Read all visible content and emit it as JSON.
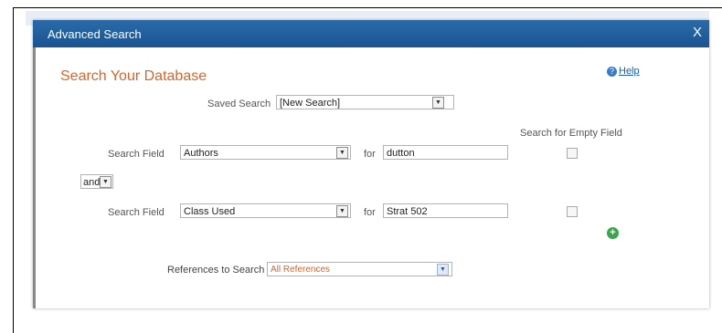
{
  "window": {
    "title": "Advanced Search",
    "close_label": "X"
  },
  "page": {
    "heading": "Search Your Database",
    "help_label": "Help"
  },
  "saved_search": {
    "label": "Saved Search",
    "value": "[New Search]"
  },
  "empty_field_header": "Search for Empty Field",
  "row1": {
    "label": "Search Field",
    "field_value": "Authors",
    "for_label": "for",
    "term": "dutton"
  },
  "operator": {
    "value": "and"
  },
  "row2": {
    "label": "Search Field",
    "field_value": "Class Used",
    "for_label": "for",
    "term": "Strat 502"
  },
  "references": {
    "label": "References to Search",
    "value": "All References"
  },
  "icons": {
    "help": "help-icon",
    "add": "plus-circle-icon",
    "dropdown": "chevron-down-icon"
  },
  "colors": {
    "titlebar": "#1a5492",
    "heading": "#d7642c",
    "add": "#36a84a"
  }
}
